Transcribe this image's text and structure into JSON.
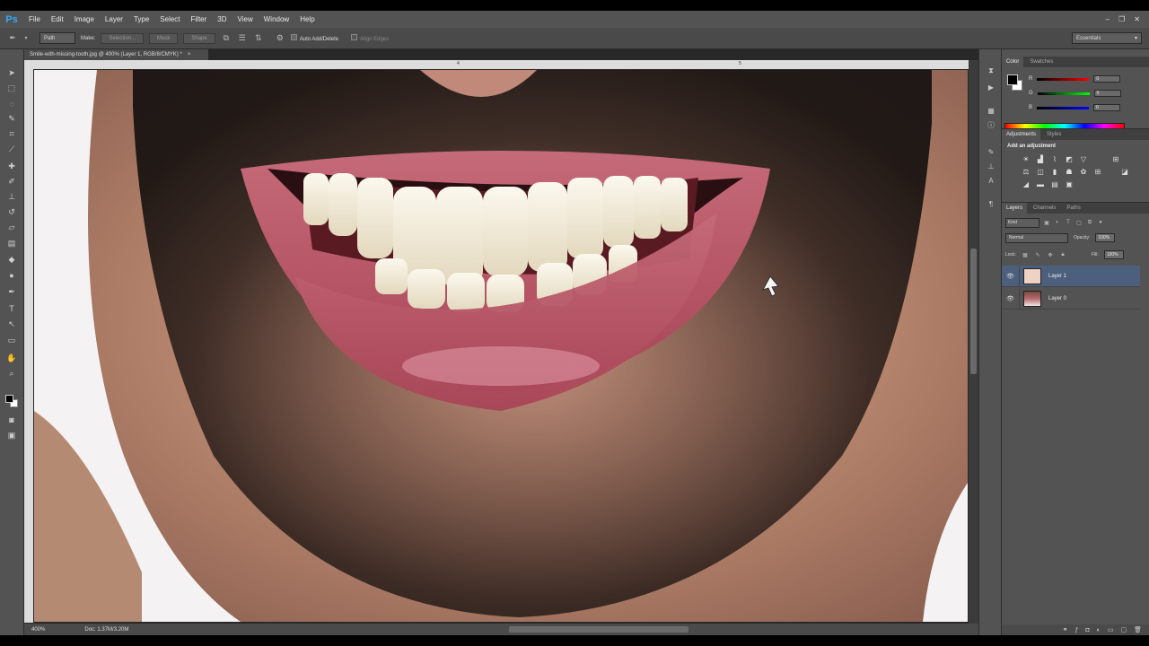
{
  "app": {
    "logo": "Ps"
  },
  "menu": [
    "File",
    "Edit",
    "Image",
    "Layer",
    "Type",
    "Select",
    "Filter",
    "3D",
    "View",
    "Window",
    "Help"
  ],
  "window_controls": {
    "minimize": "–",
    "restore": "❐",
    "close": "✕"
  },
  "options": {
    "mode_value": "Path",
    "make_label": "Make:",
    "selection_btn": "Selection...",
    "mask_btn": "Mask",
    "shape_btn": "Shape",
    "auto_add_delete": "Auto Add/Delete",
    "align_edges": "Align Edges",
    "workspace": "Essentials"
  },
  "document": {
    "tab_title": "Smile-with-missing-tooth.jpg @ 400% (Layer 1, RGB/8/CMYK) *",
    "tab_close": "×",
    "ruler_marks": [
      "4",
      "5"
    ],
    "zoom": "400%",
    "doc_info": "Doc: 1.37M/3.20M"
  },
  "color_panel": {
    "tabs": [
      "Color",
      "Swatches"
    ],
    "r_label": "R",
    "g_label": "G",
    "b_label": "B",
    "r": "0",
    "g": "0",
    "b": "0"
  },
  "adjustments_panel": {
    "tabs": [
      "Adjustments",
      "Styles"
    ],
    "title": "Add an adjustment",
    "icons": [
      "brightness-icon",
      "levels-icon",
      "curves-icon",
      "exposure-icon",
      "gradient-triangle-icon",
      "vibrance-icon",
      "hue-icon",
      "color-balance-icon",
      "bw-icon",
      "photo-filter-icon",
      "channel-mixer-icon",
      "lookup-icon",
      "invert-icon",
      "posterize-icon",
      "threshold-icon",
      "gradient-map-icon",
      "selective-color-icon"
    ]
  },
  "layers_panel": {
    "tabs": [
      "Layers",
      "Channels",
      "Paths"
    ],
    "kind": "Kind",
    "blend_mode": "Normal",
    "opacity_label": "Opacity:",
    "opacity": "100%",
    "lock_label": "Lock:",
    "fill_label": "Fill:",
    "fill": "100%",
    "layers": [
      {
        "name": "Layer 1",
        "selected": true
      },
      {
        "name": "Layer 0",
        "selected": false
      }
    ]
  },
  "colors": {
    "accent": "#31a8ff",
    "selected_layer": "#4c5f7d"
  }
}
